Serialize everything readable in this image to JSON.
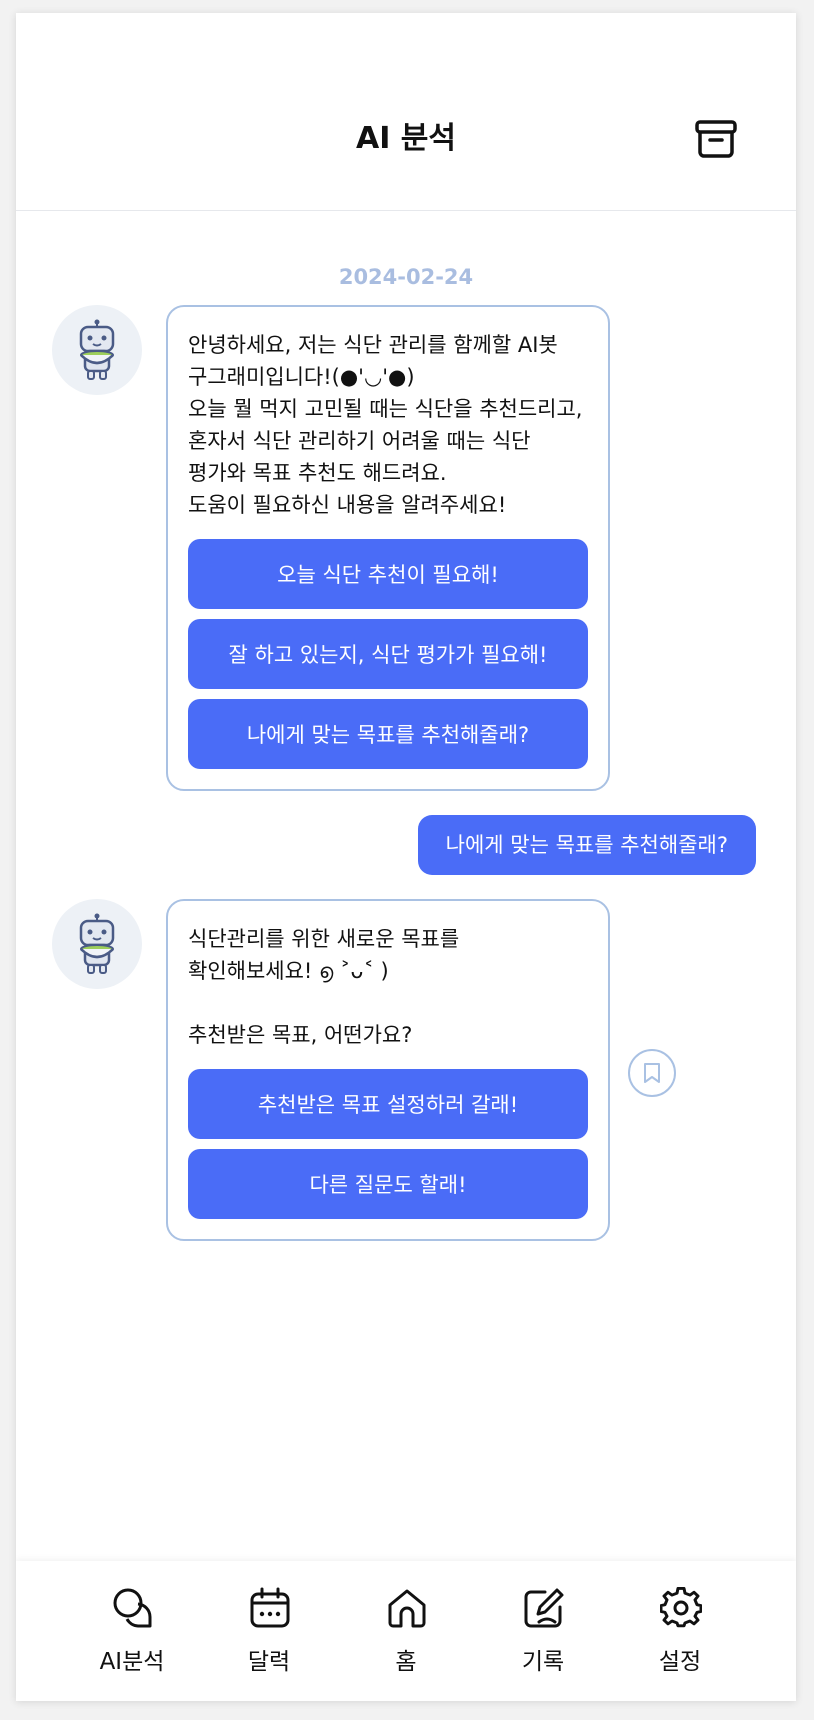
{
  "header": {
    "title": "AI 분석",
    "archive_icon": "archive-box-icon"
  },
  "chat": {
    "date": "2024-02-24",
    "messages": [
      {
        "sender": "bot",
        "avatar_icon": "robot-icon",
        "text": "안녕하세요, 저는 식단 관리를 함께할 AI봇 구그래미입니다!(●'◡'●)\n오늘 뭘 먹지 고민될 때는 식단을 추천드리고, 혼자서 식단 관리하기 어려울 때는 식단 평가와 목표 추천도 해드려요.\n도움이 필요하신 내용을 알려주세요!",
        "options": [
          "오늘 식단 추천이 필요해!",
          "잘 하고 있는지, 식단 평가가 필요해!",
          "나에게 맞는 목표를 추천해줄래?"
        ]
      },
      {
        "sender": "user",
        "text": "나에게 맞는 목표를 추천해줄래?"
      },
      {
        "sender": "bot",
        "avatar_icon": "robot-icon",
        "text": "식단관리를 위한 새로운 목표를 확인해보세요! ൭ ˃ᴗ˂ )\n\n추천받은 목표, 어떤가요?",
        "options": [
          "추천받은 목표 설정하러 갈래!",
          "다른 질문도 할래!"
        ],
        "bookmark_icon": "bookmark-icon"
      }
    ]
  },
  "tabbar": {
    "items": [
      {
        "label": "AI분석",
        "icon": "chat-bubbles-icon"
      },
      {
        "label": "달력",
        "icon": "calendar-icon"
      },
      {
        "label": "홈",
        "icon": "home-icon"
      },
      {
        "label": "기록",
        "icon": "edit-note-icon"
      },
      {
        "label": "설정",
        "icon": "gear-icon"
      }
    ]
  },
  "colors": {
    "primary": "#4a6cf7",
    "bubble_border": "#a9c1e3",
    "date_text": "#a9bde0",
    "avatar_bg": "#edf1f6"
  }
}
